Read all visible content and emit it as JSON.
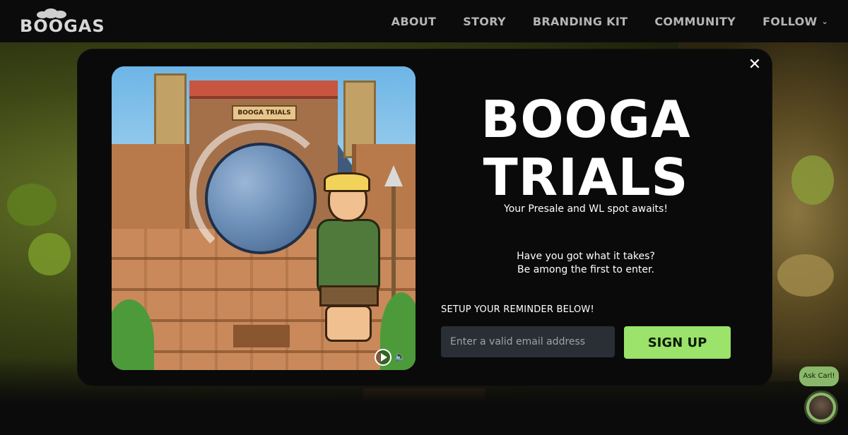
{
  "header": {
    "logo_text": "BOOGAS",
    "nav": [
      {
        "label": "ABOUT"
      },
      {
        "label": "STORY"
      },
      {
        "label": "BRANDING KIT"
      },
      {
        "label": "COMMUNITY"
      },
      {
        "label": "FOLLOW"
      }
    ]
  },
  "modal": {
    "close_icon": "close-icon",
    "art": {
      "sign_text": "BOOGA TRIALS",
      "controls": [
        "play-icon",
        "volume-icon"
      ]
    },
    "title_line1": "BOOGA",
    "title_line2": "TRIALS",
    "subtitle": "Your Presale and WL spot awaits!",
    "tagline_line1": "Have you got what it takes?",
    "tagline_line2": "Be among the first to enter.",
    "reminder_label": "SETUP YOUR REMINDER BELOW!",
    "email": {
      "placeholder": "Enter a valid email address",
      "value": ""
    },
    "signup_label": "SIGN UP"
  },
  "chat_widget": {
    "bubble_label": "Ask Carl!"
  },
  "colors": {
    "accent": "#9be36b",
    "background": "#0b0b0b",
    "input_bg": "#2a2f36"
  }
}
